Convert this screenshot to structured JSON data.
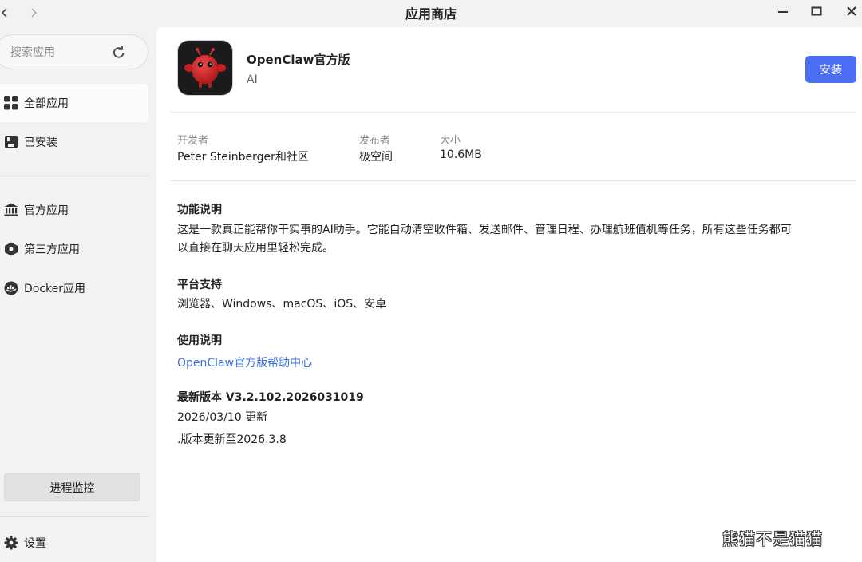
{
  "window": {
    "title": "应用商店",
    "back_icon": "chevron-left-icon",
    "forward_icon": "chevron-right-icon",
    "minimize_icon": "minimize-icon",
    "maximize_icon": "maximize-icon",
    "close_icon": "close-icon"
  },
  "sidebar": {
    "search": {
      "placeholder": "搜索应用",
      "value": ""
    },
    "refresh_icon": "refresh-icon",
    "items": [
      {
        "label": "全部应用",
        "icon": "grid-icon",
        "active": true
      },
      {
        "label": "已安装",
        "icon": "installed-icon",
        "active": false
      },
      {
        "label": "官方应用",
        "icon": "bank-icon",
        "active": false
      },
      {
        "label": "第三方应用",
        "icon": "third-party-icon",
        "active": false
      },
      {
        "label": "Docker应用",
        "icon": "docker-icon",
        "active": false
      }
    ],
    "monitor_button": "进程监控",
    "settings_label": "设置"
  },
  "app": {
    "name": "OpenClaw官方版",
    "category": "AI",
    "install_label": "安装",
    "meta": {
      "developer_label": "开发者",
      "developer": "Peter Steinberger和社区",
      "publisher_label": "发布者",
      "publisher": "极空间",
      "size_label": "大小",
      "size": "10.6MB"
    },
    "sections": {
      "description_title": "功能说明",
      "description_line1": "这是一款真正能帮你干实事的AI助手。它能自动清空收件箱、发送邮件、管理日程、办理航班值机等任务，所有这些任务都可",
      "description_line2": "以直接在聊天应用里轻松完成。",
      "platform_title": "平台支持",
      "platform_text": "浏览器、Windows、macOS、iOS、安卓",
      "usage_title": "使用说明",
      "usage_link": "OpenClaw官方版帮助中心",
      "version_title": "最新版本 V3.2.102.2026031019",
      "update_date": "2026/03/10 更新",
      "update_note": ".版本更新至2026.3.8"
    }
  },
  "watermark": "熊猫不是猫猫",
  "colors": {
    "accent": "#4c6ef5",
    "link": "#3d6fe0",
    "sidebar_bg": "#f2f2f2",
    "panel_bg": "#ffffff"
  }
}
